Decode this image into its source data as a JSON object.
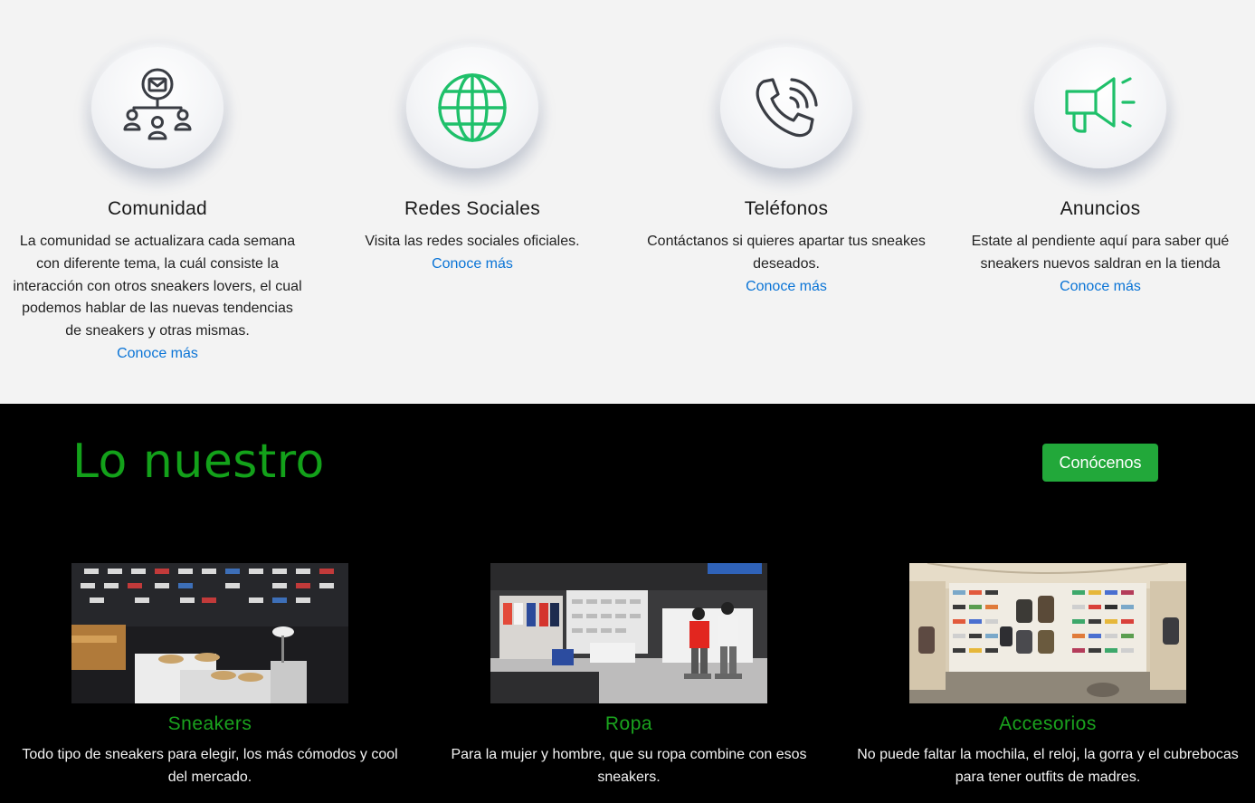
{
  "features": [
    {
      "icon": "community-mail-icon",
      "title": "Comunidad",
      "desc": "La comunidad se actualizara cada semana con diferente tema, la cuál consiste la interacción con otros sneakers lovers, el cual podemos hablar de las nuevas tendencias de sneakers y otras mismas.",
      "link": "Conoce más"
    },
    {
      "icon": "globe-icon",
      "title": "Redes Sociales",
      "desc": "Visita las redes sociales oficiales.",
      "link": "Conoce más"
    },
    {
      "icon": "phone-icon",
      "title": "Teléfonos",
      "desc": "Contáctanos si quieres apartar tus sneakes deseados.",
      "link": "Conoce más"
    },
    {
      "icon": "megaphone-icon",
      "title": "Anuncios",
      "desc": "Estate al pendiente aquí para saber qué sneakers nuevos saldran en la tienda",
      "link": "Conoce más"
    }
  ],
  "about": {
    "title": "Lo nuestro",
    "cta_label": "Conócenos",
    "cards": [
      {
        "image": "sneaker-store-wall-photo",
        "title": "Sneakers",
        "desc": "Todo tipo de sneakers para elegir, los más cómodos y cool del mercado."
      },
      {
        "image": "clothing-store-photo",
        "title": "Ropa",
        "desc": "Para la mujer y hombre, que su ropa combine con esos sneakers."
      },
      {
        "image": "accessories-store-photo",
        "title": "Accesorios",
        "desc": "No puede faltar la mochila, el reloj, la gorra y el cubrebocas para tener outfits de madres."
      }
    ]
  },
  "colors": {
    "accent_green": "#13a11a",
    "button_green": "#22a83a",
    "link_blue": "#0a74d6",
    "dark_bg": "#000000",
    "light_bg": "#f3f3f3"
  }
}
